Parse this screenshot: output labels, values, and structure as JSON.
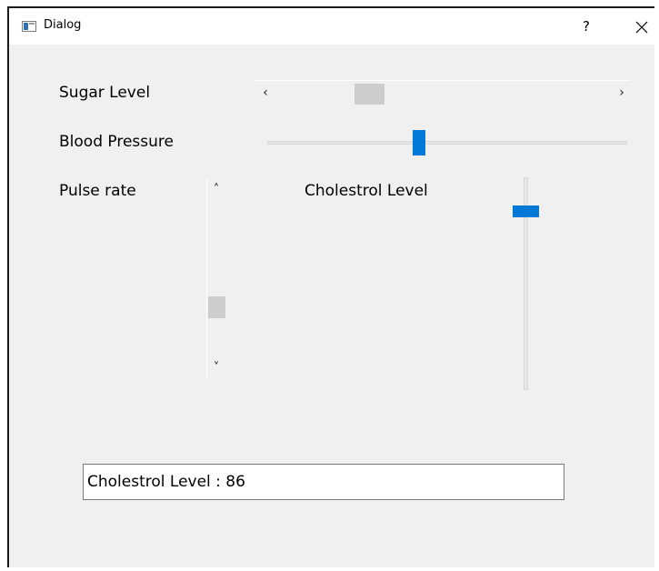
{
  "window": {
    "title": "Dialog",
    "help_label": "?",
    "close_label": "×"
  },
  "controls": {
    "sugar_level": {
      "label": "Sugar Level",
      "widget": "horizontal-scrollbar",
      "left_arrow": "‹",
      "right_arrow": "›",
      "value_fraction": 0.26
    },
    "blood_pressure": {
      "label": "Blood Pressure",
      "widget": "horizontal-slider",
      "value_fraction": 0.42
    },
    "pulse_rate": {
      "label": "Pulse rate",
      "widget": "vertical-scrollbar",
      "up_arrow": "˄",
      "down_arrow": "˅",
      "value_fraction": 0.71
    },
    "cholestrol_level": {
      "label": "Cholestrol Level",
      "widget": "vertical-slider",
      "value_fraction": 0.86
    }
  },
  "output": {
    "text": "Cholestrol Level : 86"
  },
  "colors": {
    "accent": "#0078d7",
    "scroll_thumb": "#cdcdcd",
    "dialog_background": "#f0f0f0"
  }
}
